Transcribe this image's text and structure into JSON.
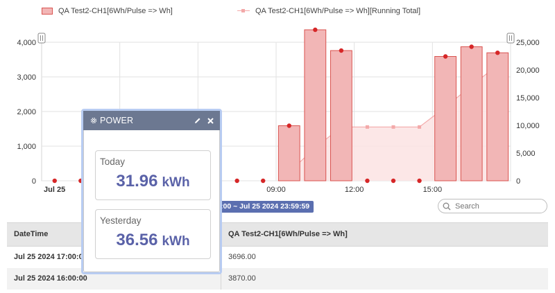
{
  "legend": {
    "bar_series": "QA Test2-CH1[6Wh/Pulse => Wh]",
    "line_series": "QA Test2-CH1[6Wh/Pulse => Wh][Running Total]"
  },
  "colors": {
    "bar_fill": "#f2b6b6",
    "bar_stroke": "#d9534f",
    "bar_dot": "#d62728",
    "line_color": "#f3a9a9",
    "area_fill": "#fbe3e3",
    "widget_header": "#6c7891",
    "widget_value": "#5a62a8",
    "range_badge": "#5b6fb0"
  },
  "chart_data": {
    "type": "bar",
    "x_unit": "hour of Jul 25 2024",
    "x": [
      0,
      1,
      2,
      3,
      4,
      5,
      6,
      7,
      8,
      9,
      10,
      11,
      12,
      13,
      14,
      15,
      16,
      17
    ],
    "series": [
      {
        "name": "QA Test2-CH1[6Wh/Pulse => Wh]",
        "type": "bar",
        "axis": "left",
        "values": [
          0,
          0,
          0,
          0,
          0,
          0,
          0,
          0,
          0,
          1590,
          4360,
          3760,
          0,
          0,
          0,
          3590,
          3870,
          3696
        ]
      },
      {
        "name": "QA Test2-CH1[6Wh/Pulse => Wh][Running Total]",
        "type": "area",
        "axis": "right",
        "values": [
          null,
          null,
          null,
          null,
          null,
          null,
          null,
          null,
          null,
          1590,
          5950,
          9710,
          9710,
          9710,
          9710,
          13300,
          17170,
          20866
        ]
      }
    ],
    "y_left": {
      "ticks": [
        "0",
        "1,000",
        "2,000",
        "3,000",
        "4,000"
      ],
      "range": [
        0,
        4000
      ]
    },
    "y_right": {
      "ticks": [
        "0",
        "5,000",
        "10,000",
        "15,000",
        "20,000",
        "25,000"
      ],
      "range": [
        0,
        25000
      ]
    },
    "x_ticks": [
      {
        "hour": 0,
        "label": "Jul 25"
      },
      {
        "hour": 9,
        "label": "09:00"
      },
      {
        "hour": 12,
        "label": "12:00"
      },
      {
        "hour": 15,
        "label": "15:00"
      }
    ]
  },
  "range_label": ":00 ~ Jul 25 2024 23:59:59",
  "search": {
    "placeholder": "Search"
  },
  "table": {
    "headers": [
      "DateTime",
      "QA Test2-CH1[6Wh/Pulse => Wh]"
    ],
    "rows": [
      [
        "Jul 25 2024 17:00:00",
        "3696.00"
      ],
      [
        "Jul 25 2024 16:00:00",
        "3870.00"
      ]
    ]
  },
  "widget": {
    "title": "POWER",
    "today": {
      "label": "Today",
      "value": "31.96",
      "unit": "kWh"
    },
    "yesterday": {
      "label": "Yesterday",
      "value": "36.56",
      "unit": "kWh"
    }
  }
}
